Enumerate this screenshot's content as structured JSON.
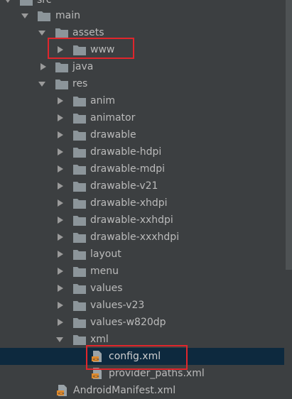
{
  "tree": {
    "rows": [
      {
        "label": "src",
        "icon": "folder",
        "expanded": true
      },
      {
        "label": "main",
        "icon": "folder",
        "expanded": true
      },
      {
        "label": "assets",
        "icon": "folder",
        "expanded": true
      },
      {
        "label": "www",
        "icon": "folder",
        "expanded": false
      },
      {
        "label": "java",
        "icon": "folder",
        "expanded": false
      },
      {
        "label": "res",
        "icon": "folder",
        "expanded": true
      },
      {
        "label": "anim",
        "icon": "folder",
        "expanded": false
      },
      {
        "label": "animator",
        "icon": "folder",
        "expanded": false
      },
      {
        "label": "drawable",
        "icon": "folder",
        "expanded": false
      },
      {
        "label": "drawable-hdpi",
        "icon": "folder",
        "expanded": false
      },
      {
        "label": "drawable-mdpi",
        "icon": "folder",
        "expanded": false
      },
      {
        "label": "drawable-v21",
        "icon": "folder",
        "expanded": false
      },
      {
        "label": "drawable-xhdpi",
        "icon": "folder",
        "expanded": false
      },
      {
        "label": "drawable-xxhdpi",
        "icon": "folder",
        "expanded": false
      },
      {
        "label": "drawable-xxxhdpi",
        "icon": "folder",
        "expanded": false
      },
      {
        "label": "layout",
        "icon": "folder",
        "expanded": false
      },
      {
        "label": "menu",
        "icon": "folder",
        "expanded": false
      },
      {
        "label": "values",
        "icon": "folder",
        "expanded": false
      },
      {
        "label": "values-v23",
        "icon": "folder",
        "expanded": false
      },
      {
        "label": "values-w820dp",
        "icon": "folder",
        "expanded": false
      },
      {
        "label": "xml",
        "icon": "folder",
        "expanded": true
      },
      {
        "label": "config.xml",
        "icon": "xml-file"
      },
      {
        "label": "provider_paths.xml",
        "icon": "xml-file"
      },
      {
        "label": "AndroidManifest.xml",
        "icon": "xml-file"
      }
    ]
  },
  "colors": {
    "background": "#3c3f41",
    "selection": "#0d293e",
    "text": "#bbbbbb",
    "folder": "#8c959a",
    "highlight_box": "#e0262c",
    "xml_icon_accent": "#e08a2c"
  }
}
